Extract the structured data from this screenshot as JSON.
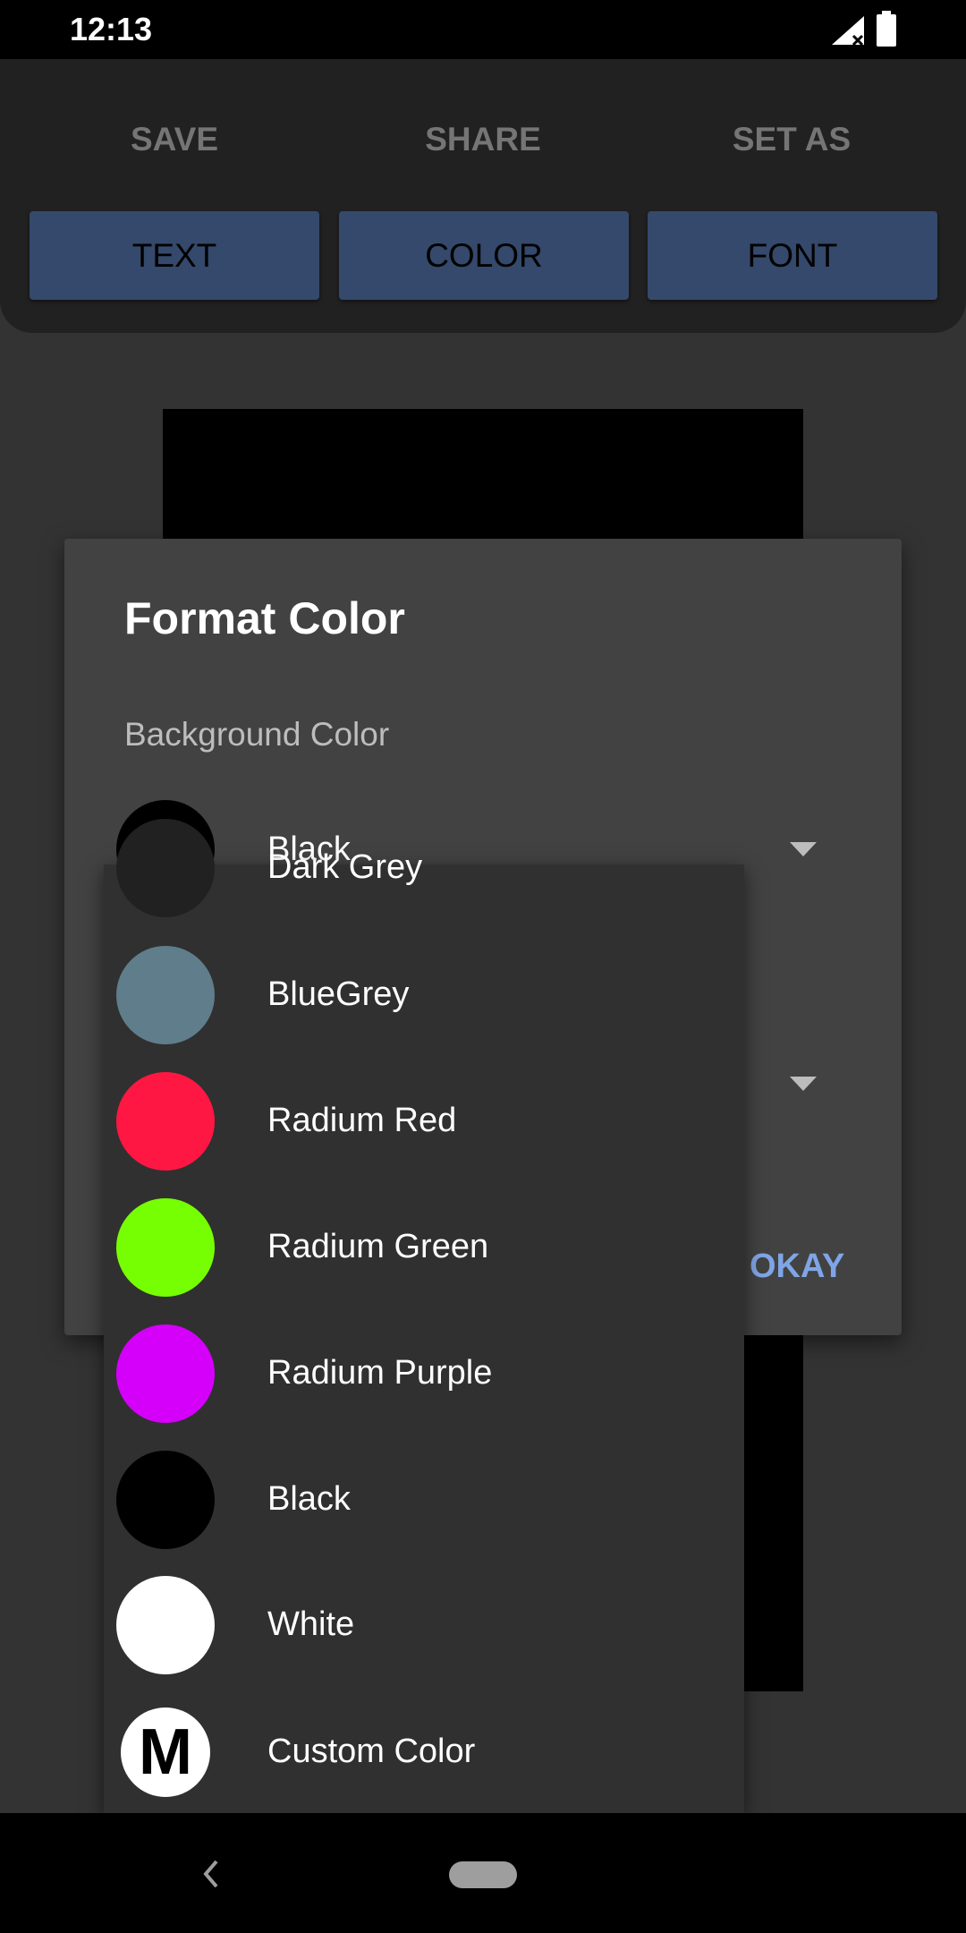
{
  "status_bar": {
    "time": "12:13",
    "icons": [
      "signal-no-data-icon",
      "battery-icon"
    ]
  },
  "toolbar": {
    "actions": [
      "SAVE",
      "SHARE",
      "SET AS"
    ],
    "tabs": [
      "TEXT",
      "COLOR",
      "FONT"
    ]
  },
  "dialog": {
    "title": "Format Color",
    "background_label": "Background Color",
    "selected_background": {
      "label": "Black",
      "color": "#000000"
    },
    "okay_label": "OKAY"
  },
  "dropdown": {
    "items": [
      {
        "label": "Dark Grey",
        "color": "#212121"
      },
      {
        "label": "BlueGrey",
        "color": "#607d8b"
      },
      {
        "label": "Radium Red",
        "color": "#ff1744"
      },
      {
        "label": "Radium Green",
        "color": "#76ff03"
      },
      {
        "label": "Radium Purple",
        "color": "#d500f9"
      },
      {
        "label": "Black",
        "color": "#000000"
      },
      {
        "label": "White",
        "color": "#ffffff"
      },
      {
        "label": "Custom Color",
        "color": "#ffffff",
        "icon_letter": "M"
      }
    ]
  },
  "nav": {
    "icons": [
      "back-icon",
      "home-pill-icon"
    ]
  }
}
